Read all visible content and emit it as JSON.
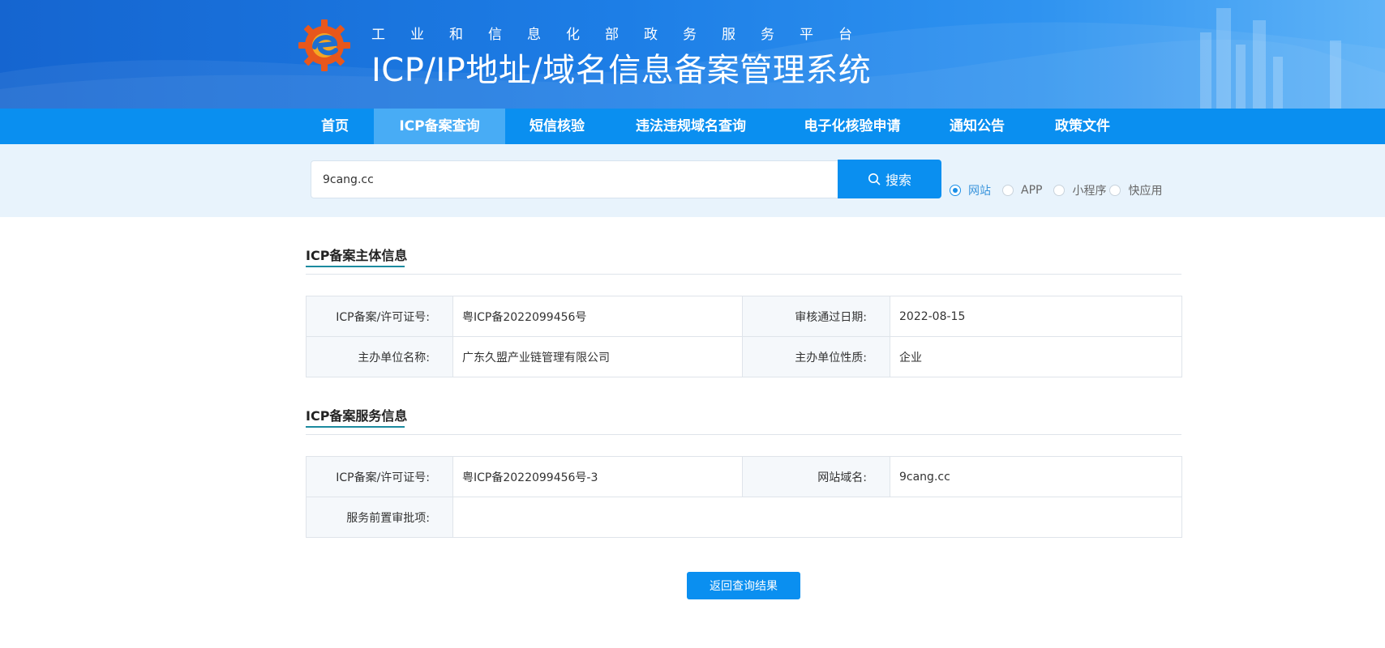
{
  "header": {
    "platform_name": "工业和信息化部政务服务平台",
    "system_title": "ICP/IP地址/域名信息备案管理系统"
  },
  "nav": {
    "items": [
      {
        "label": "首页"
      },
      {
        "label": "ICP备案查询",
        "active": true
      },
      {
        "label": "短信核验"
      },
      {
        "label": "违法违规域名查询"
      },
      {
        "label": "电子化核验申请"
      },
      {
        "label": "通知公告"
      },
      {
        "label": "政策文件"
      }
    ]
  },
  "search": {
    "value": "9cang.cc",
    "button_label": "搜索",
    "types": [
      {
        "label": "网站",
        "checked": true
      },
      {
        "label": "APP",
        "checked": false
      },
      {
        "label": "小程序",
        "checked": false
      },
      {
        "label": "快应用",
        "checked": false
      }
    ]
  },
  "subject_info": {
    "title": "ICP备案主体信息",
    "rows": [
      {
        "label1": "ICP备案/许可证号:",
        "value1": "粤ICP备2022099456号",
        "label2": "审核通过日期:",
        "value2": "2022-08-15"
      },
      {
        "label1": "主办单位名称:",
        "value1": "广东久盟产业链管理有限公司",
        "label2": "主办单位性质:",
        "value2": "企业"
      }
    ]
  },
  "service_info": {
    "title": "ICP备案服务信息",
    "row1": {
      "label1": "ICP备案/许可证号:",
      "value1": "粤ICP备2022099456号-3",
      "label2": "网站域名:",
      "value2": "9cang.cc"
    },
    "row2": {
      "label": "服务前置审批项:",
      "value": ""
    }
  },
  "back_button_label": "返回查询结果",
  "colors": {
    "primary": "#0a8ff0",
    "nav_active": "#48acf5",
    "section_accent": "#1b8a9f",
    "search_band": "#e8f3fc"
  }
}
